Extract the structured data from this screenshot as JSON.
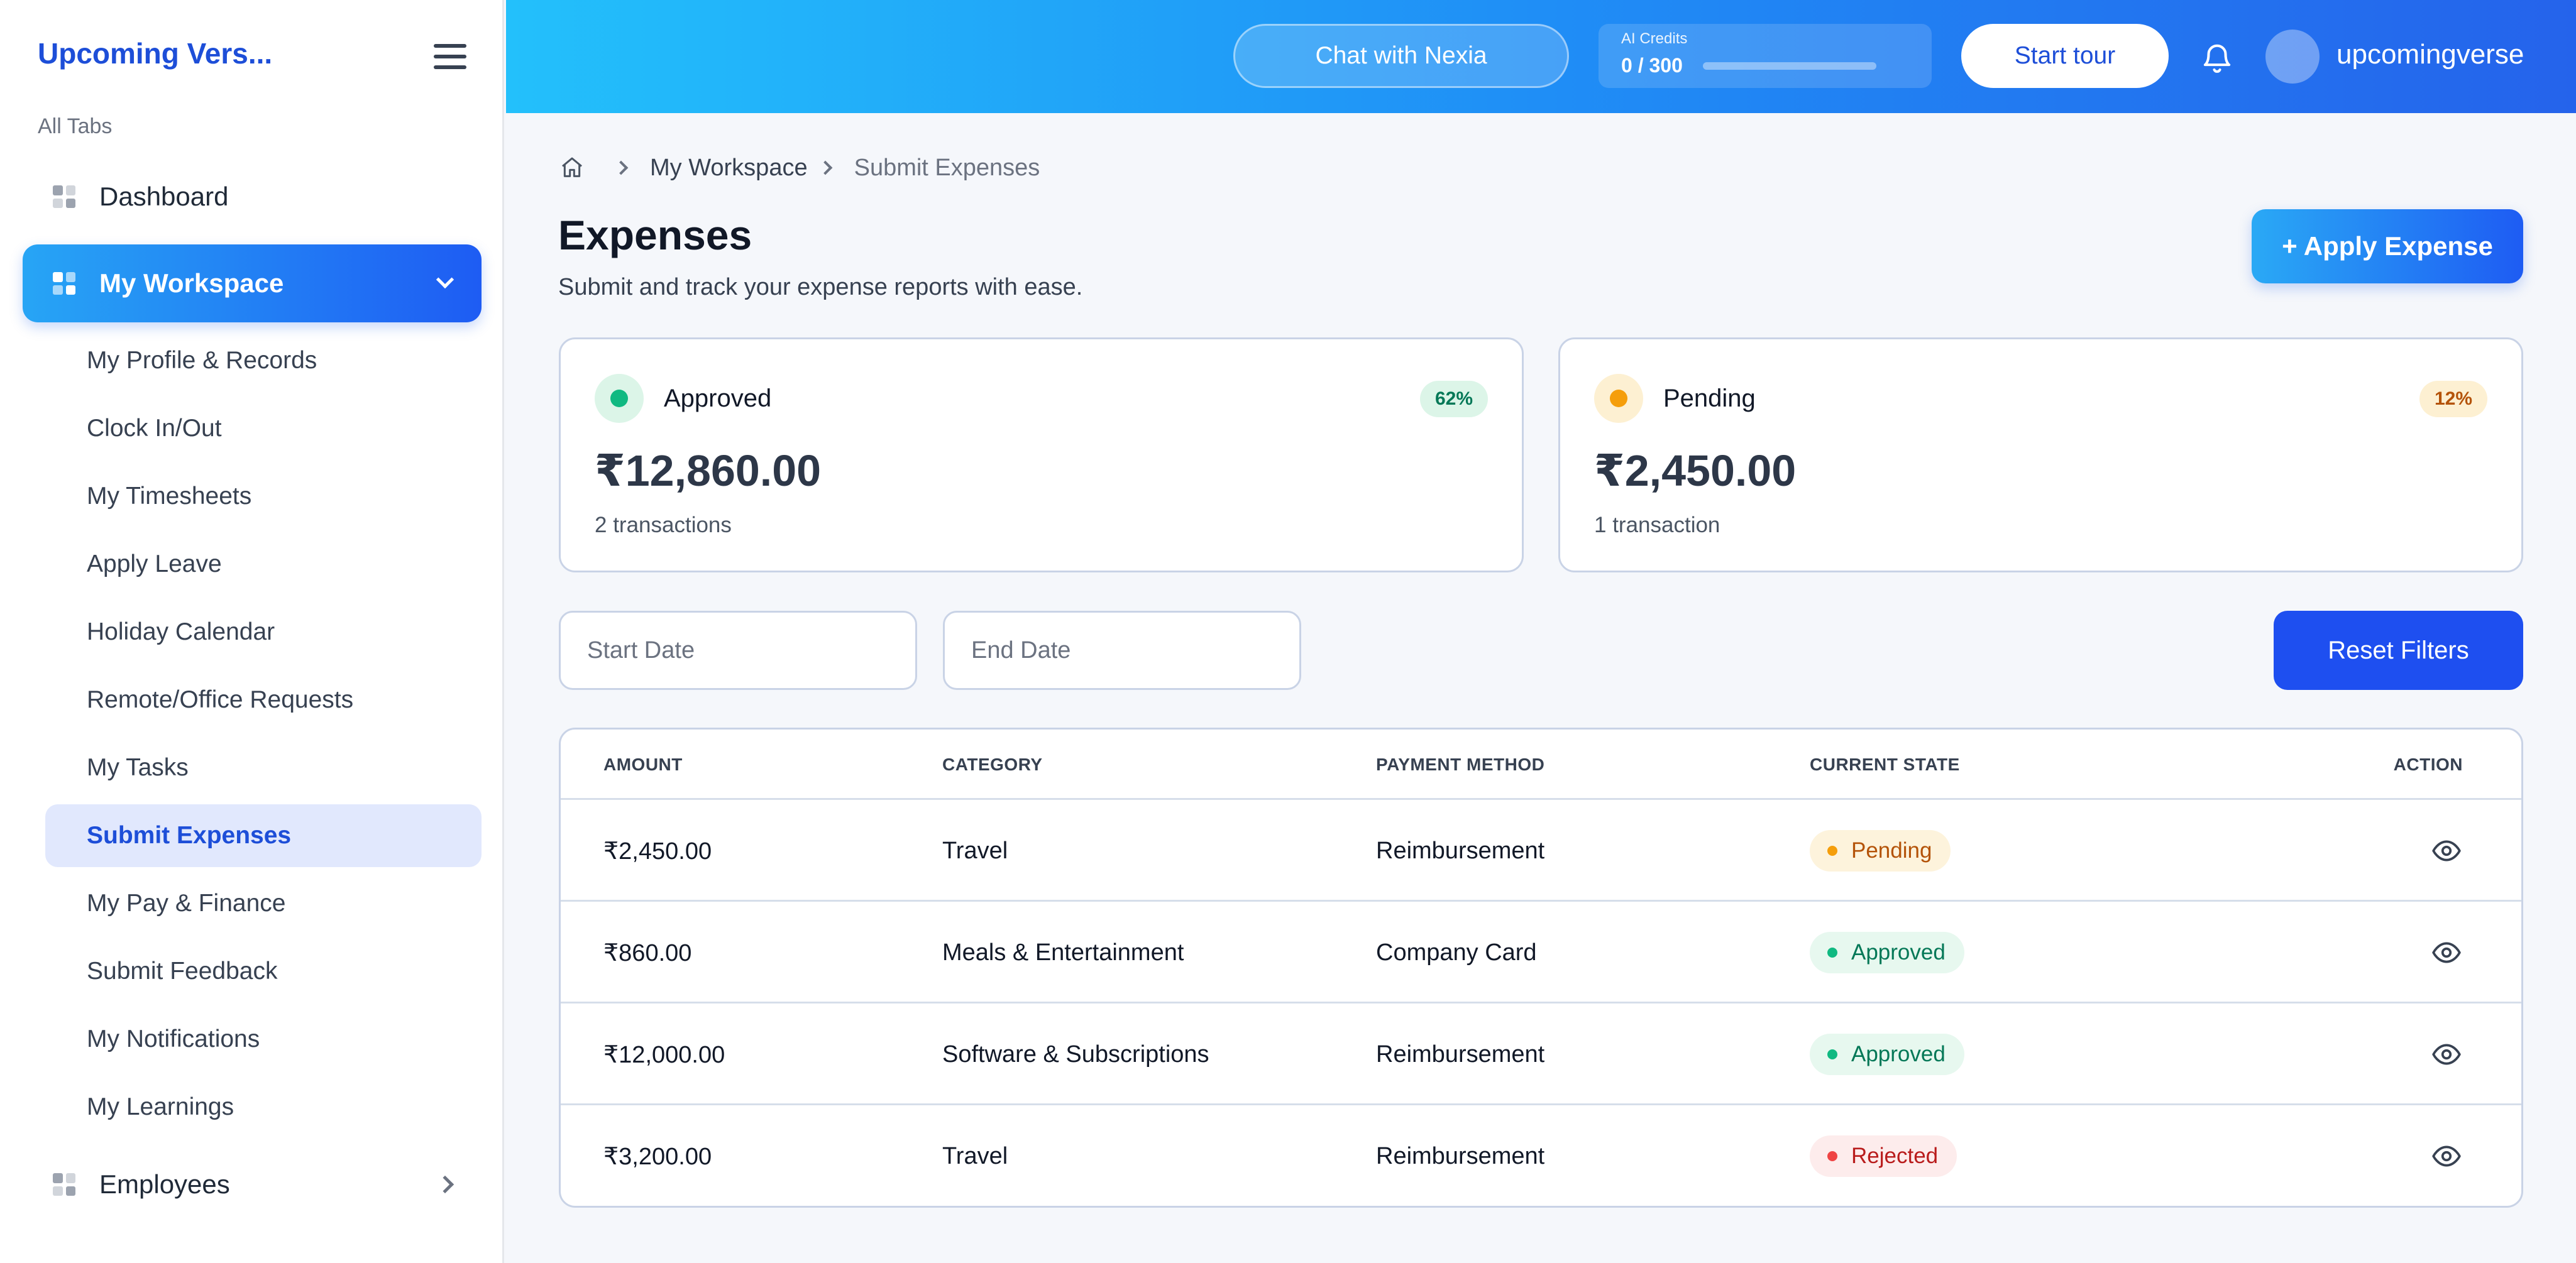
{
  "sidebar": {
    "brand": "Upcoming Vers...",
    "section_label": "All Tabs",
    "dashboard": "Dashboard",
    "workspace": "My Workspace",
    "workspace_items": [
      "My Profile & Records",
      "Clock In/Out",
      "My Timesheets",
      "Apply Leave",
      "Holiday Calendar",
      "Remote/Office Requests",
      "My Tasks",
      "Submit Expenses",
      "My Pay & Finance",
      "Submit Feedback",
      "My Notifications",
      "My Learnings"
    ],
    "selected_item": "Submit Expenses",
    "employees": "Employees"
  },
  "header": {
    "chat_label": "Chat with Nexia",
    "credits_label": "AI Credits",
    "credits_value": "0 / 300",
    "credits_used_fraction": 0,
    "tour_label": "Start tour",
    "username": "upcomingverse"
  },
  "breadcrumb": {
    "items": [
      "My Workspace",
      "Submit Expenses"
    ]
  },
  "page": {
    "title": "Expenses",
    "subtitle": "Submit and track your expense reports with ease.",
    "apply_button": "+ Apply Expense"
  },
  "summary": {
    "approved": {
      "label": "Approved",
      "percent": "62%",
      "amount": "₹12,860.00",
      "transactions": "2 transactions"
    },
    "pending": {
      "label": "Pending",
      "percent": "12%",
      "amount": "₹2,450.00",
      "transactions": "1 transaction"
    }
  },
  "filters": {
    "start_placeholder": "Start Date",
    "end_placeholder": "End Date",
    "reset_label": "Reset Filters"
  },
  "table": {
    "columns": [
      "AMOUNT",
      "CATEGORY",
      "PAYMENT METHOD",
      "CURRENT STATE",
      "ACTION"
    ],
    "rows": [
      {
        "amount": "₹2,450.00",
        "category": "Travel",
        "method": "Reimbursement",
        "state": "Pending"
      },
      {
        "amount": "₹860.00",
        "category": "Meals & Entertainment",
        "method": "Company Card",
        "state": "Approved"
      },
      {
        "amount": "₹12,000.00",
        "category": "Software & Subscriptions",
        "method": "Reimbursement",
        "state": "Approved"
      },
      {
        "amount": "₹3,200.00",
        "category": "Travel",
        "method": "Reimbursement",
        "state": "Rejected"
      }
    ]
  },
  "colors": {
    "accent": "#1e4ff0",
    "approved_dot": "#10b981",
    "approved_bg": "#e7f8ef",
    "approved_text": "#047857",
    "pending_dot": "#f59e0b",
    "pending_bg": "#fdf3dc",
    "pending_text": "#b45309",
    "rejected_dot": "#ef4444",
    "rejected_bg": "#fdecec",
    "rejected_text": "#b91c1c"
  },
  "icons": {
    "menu": "hamburger-icon",
    "nav": "grid-icon",
    "notifications": "bell-icon",
    "home": "home-icon",
    "view": "eye-icon"
  }
}
